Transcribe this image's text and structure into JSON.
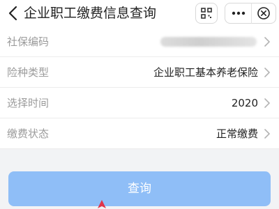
{
  "header": {
    "title": "企业职工缴费信息查询",
    "back_icon": "chevron-left-icon",
    "scan_icon": "scan-icon",
    "more_icon": "more-dots-icon",
    "close_icon": "close-circle-icon"
  },
  "form": {
    "rows": [
      {
        "label": "社保编码",
        "value": ""
      },
      {
        "label": "险种类型",
        "value": "企业职工基本养老保险"
      },
      {
        "label": "选择时间",
        "value": "2020"
      },
      {
        "label": "缴费状态",
        "value": "正常缴费"
      }
    ]
  },
  "actions": {
    "query_label": "查询"
  },
  "colors": {
    "accent": "#8fbef7",
    "pointer": "#e0344a"
  }
}
